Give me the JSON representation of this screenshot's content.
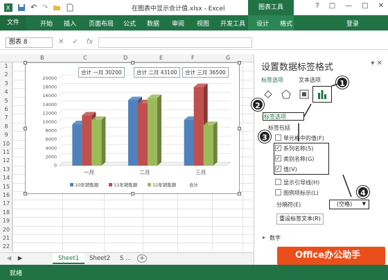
{
  "window": {
    "title": "在图表中显示合计值.xlsx - Excel",
    "chart_tools": "图表工具",
    "controls": [
      "?",
      "□",
      "—",
      "□",
      "✕"
    ],
    "login": "登录"
  },
  "ribbon": {
    "file": "文件",
    "tabs": [
      "开始",
      "插入",
      "页面布局",
      "公式",
      "数据",
      "审阅",
      "视图",
      "开发工具",
      "设计",
      "格式"
    ]
  },
  "formula": {
    "namebox": "图表 8",
    "cancel": "✕",
    "enter": "✓",
    "fx": "fx"
  },
  "grid": {
    "columns": [
      "B",
      "C",
      "D",
      "E",
      "F",
      "G"
    ],
    "rows": [
      "1",
      "2",
      "3",
      "4",
      "5",
      "6",
      "7",
      "8",
      "9",
      "10",
      "11",
      "12",
      "13",
      "14",
      "15",
      "16",
      "17",
      "18",
      "19",
      "20",
      "21",
      "22"
    ]
  },
  "chart_data": {
    "type": "bar",
    "categories": [
      "一月",
      "二月",
      "三月"
    ],
    "series": [
      {
        "name": "10年销售额",
        "values": [
          9500,
          15000,
          10500
        ],
        "color": "#4f81bd"
      },
      {
        "name": "11年销售额",
        "values": [
          11500,
          14300,
          18000
        ],
        "color": "#c0504d"
      },
      {
        "name": "12年销售额",
        "values": [
          10500,
          15500,
          9300
        ],
        "color": "#9bbb59"
      }
    ],
    "total_series": "合计",
    "ylim": [
      0,
      20000
    ],
    "yticks": [
      "0",
      "2000",
      "4000",
      "6000",
      "8000",
      "10000",
      "12000",
      "14000",
      "16000",
      "18000",
      "20000"
    ],
    "data_labels": [
      "合计 一月 30200",
      "合计 二月 43100",
      "合计 三月 36500"
    ],
    "legend": "bottom"
  },
  "sheets": {
    "tabs": [
      "Sheet1",
      "Sheet2",
      "S ..."
    ],
    "add": "+"
  },
  "status": {
    "ready": "就绪"
  },
  "pane": {
    "title": "设置数据标签格式",
    "tab_label_options": "标签选项",
    "tab_text_options": "文本选项",
    "section_label_options": "标签选项",
    "label_contains": "标签包括",
    "options": [
      {
        "label": "单元格中的值(F)",
        "checked": false
      },
      {
        "label": "系列名称(S)",
        "checked": true
      },
      {
        "label": "类别名称(G)",
        "checked": true
      },
      {
        "label": "值(V)",
        "checked": true
      },
      {
        "label": "显示引导线(H)",
        "checked": false
      },
      {
        "label": "图例项标示(L)",
        "checked": false
      }
    ],
    "separator_label": "分隔符(E)",
    "separator_value": "(空格)",
    "reset_button": "重设标签文本(R)",
    "section_number": "数字",
    "callouts": [
      "1",
      "2",
      "3",
      "4"
    ]
  },
  "brand": {
    "text": "Office办公助手"
  }
}
